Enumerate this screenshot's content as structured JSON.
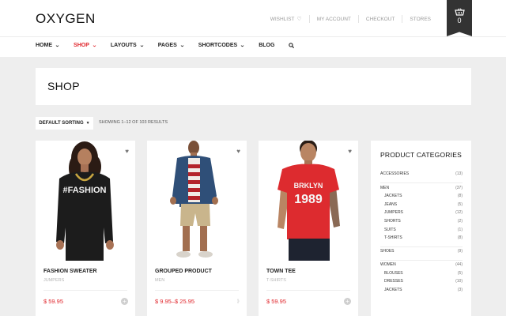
{
  "header": {
    "logo": "OXYGEN",
    "top_links": [
      "WISHLIST",
      "MY ACCOUNT",
      "CHECKOUT",
      "STORES"
    ],
    "cart_count": "0"
  },
  "nav": {
    "items": [
      {
        "label": "HOME",
        "dropdown": true
      },
      {
        "label": "SHOP",
        "dropdown": true,
        "active": true
      },
      {
        "label": "LAYOUTS",
        "dropdown": true
      },
      {
        "label": "PAGES",
        "dropdown": true
      },
      {
        "label": "SHORTCODES",
        "dropdown": true
      },
      {
        "label": "BLOG",
        "dropdown": false
      }
    ]
  },
  "page": {
    "title": "SHOP",
    "sort_label": "DEFAULT SORTING",
    "results_text": "SHOWING 1–12 OF 103 RESULTS"
  },
  "products": [
    {
      "name": "FASHION SWEATER",
      "category": "JUMPERS",
      "price": "$ 59.95"
    },
    {
      "name": "GROUPED PRODUCT",
      "category": "MEN",
      "price": "$ 9.95–$ 25.95"
    },
    {
      "name": "TOWN TEE",
      "category": "T-SHIRTS",
      "price": "$ 59.95"
    }
  ],
  "sidebar": {
    "title": "PRODUCT CATEGORIES",
    "categories": [
      {
        "label": "ACCESSORIES",
        "count": "(13)"
      },
      {
        "label": "MEN",
        "count": "(37)"
      },
      {
        "label": "JACKETS",
        "count": "(8)"
      },
      {
        "label": "JEANS",
        "count": "(5)"
      },
      {
        "label": "JUMPERS",
        "count": "(12)"
      },
      {
        "label": "SHORTS",
        "count": "(2)"
      },
      {
        "label": "SUITS",
        "count": "(1)"
      },
      {
        "label": "T-SHIRTS",
        "count": "(8)"
      },
      {
        "label": "SHOES",
        "count": "(9)"
      },
      {
        "label": "WOMEN",
        "count": "(44)"
      },
      {
        "label": "BLOUSES",
        "count": "(5)"
      },
      {
        "label": "DRESSES",
        "count": "(10)"
      },
      {
        "label": "JACKETS",
        "count": "(3)"
      }
    ]
  },
  "graphics": {
    "tee_print_line1": "BRKLYN",
    "tee_print_line2": "1989",
    "sweater_print": "#FASHION"
  },
  "colors": {
    "accent": "#e0262c",
    "cart_bg": "#333333",
    "page_bg": "#eeeeee"
  }
}
